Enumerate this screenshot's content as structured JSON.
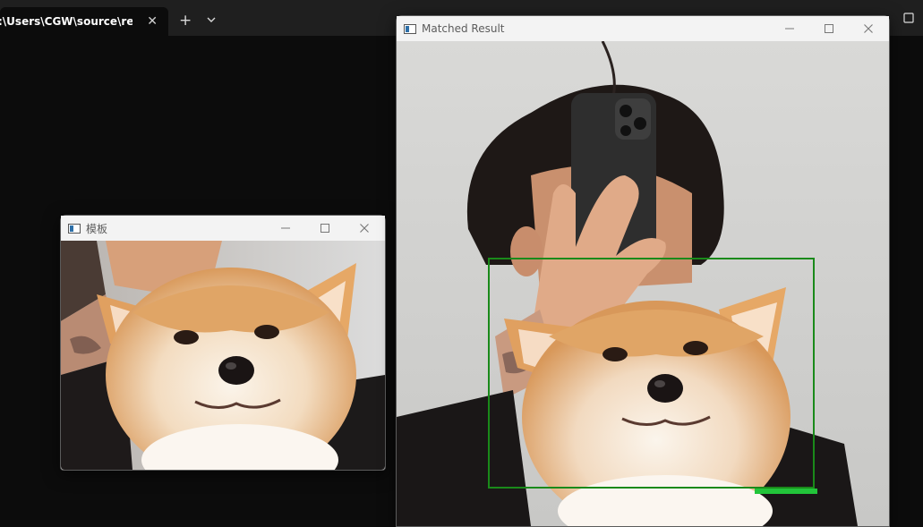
{
  "terminal": {
    "tab_title": ":\\Users\\CGW\\source\\repos\\",
    "close_glyph": "✕",
    "new_tab_glyph": "+",
    "icons": {
      "close": "close-icon",
      "new_tab": "plus-icon",
      "dropdown": "chevron-down-icon",
      "maximize": "maximize-icon"
    }
  },
  "template_window": {
    "title": "模板",
    "icons": {
      "app": "opencv-window-icon",
      "minimize": "minimize-icon",
      "maximize": "maximize-icon",
      "close": "close-icon"
    },
    "image": "shiba-inu-dog-face"
  },
  "result_window": {
    "title": "Matched Result",
    "icons": {
      "app": "opencv-window-icon",
      "minimize": "minimize-icon",
      "maximize": "maximize-icon",
      "close": "close-icon"
    },
    "image": "person-taking-selfie-with-shiba-inu",
    "match_box_color": "#1a8a1a"
  },
  "colors": {
    "terminal_bg": "#0c0c0c",
    "tabbar_bg": "#1f1f1f",
    "window_titlebar": "#f3f3f3",
    "match_box": "#1a8a1a"
  }
}
